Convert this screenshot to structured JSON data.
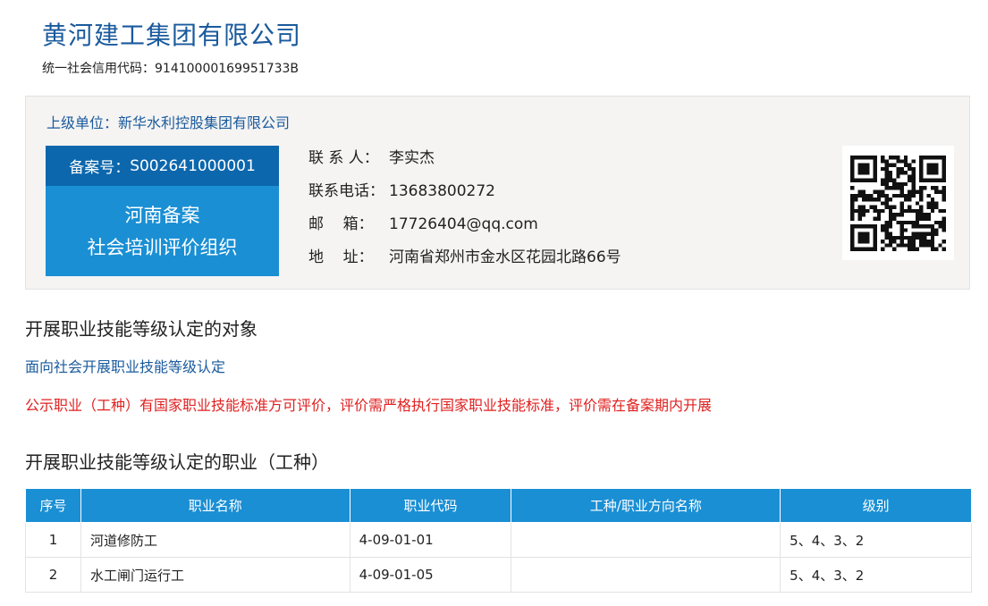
{
  "company": {
    "name": "黄河建工集团有限公司",
    "credit_code_label": "统一社会信用代码：",
    "credit_code": "91410000169951733B"
  },
  "panel": {
    "parent_unit_label": "上级单位：",
    "parent_unit": "新华水利控股集团有限公司",
    "badge": {
      "record_label": "备案号：",
      "record_no": "S002641000001",
      "line1": "河南备案",
      "line2": "社会培训评价组织"
    },
    "contacts": [
      {
        "label": "联 系 人：",
        "value": "李实杰"
      },
      {
        "label": "联系电话：",
        "value": "13683800272"
      },
      {
        "label": "邮    箱：",
        "value": "17726404@qq.com"
      },
      {
        "label": "地    址：",
        "value": "河南省郑州市金水区花园北路66号"
      }
    ],
    "qr_icon": "qr-code-icon"
  },
  "section_target": {
    "title": "开展职业技能等级认定的对象",
    "target": "面向社会开展职业技能等级认定",
    "notice": "公示职业（工种）有国家职业技能标准方可评价，评价需严格执行国家职业技能标准，评价需在备案期内开展"
  },
  "section_occupations": {
    "title": "开展职业技能等级认定的职业（工种）",
    "headers": [
      "序号",
      "职业名称",
      "职业代码",
      "工种/职业方向名称",
      "级别"
    ],
    "rows": [
      {
        "no": "1",
        "name": "河道修防工",
        "code": "4-09-01-01",
        "direction": "",
        "level": "5、4、3、2"
      },
      {
        "no": "2",
        "name": "水工闸门运行工",
        "code": "4-09-01-05",
        "direction": "",
        "level": "5、4、3、2"
      }
    ]
  },
  "colors": {
    "brand_blue": "#1a5a9c",
    "header_blue": "#1a8fd4",
    "badge_dark": "#0c67ad",
    "notice_red": "#e02020"
  }
}
